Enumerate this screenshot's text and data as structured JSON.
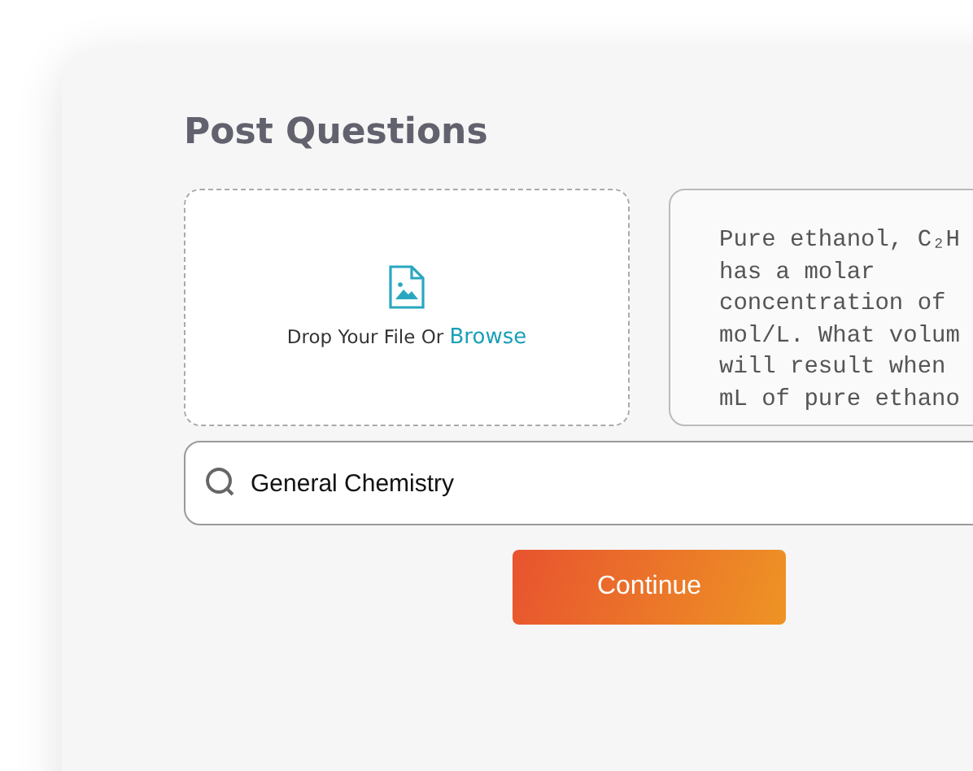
{
  "title": "Post Questions",
  "upload": {
    "prompt": "Drop Your File Or",
    "link": "Browse"
  },
  "question": {
    "lines": [
      "Pure ethanol, C₂H",
      "has a molar",
      "concentration of",
      "mol/L. What volum",
      "will result when",
      "mL of pure ethano"
    ]
  },
  "subject": {
    "value": "General Chemistry"
  },
  "buttons": [
    {
      "label": "Continue",
      "kind": "primary"
    }
  ]
}
